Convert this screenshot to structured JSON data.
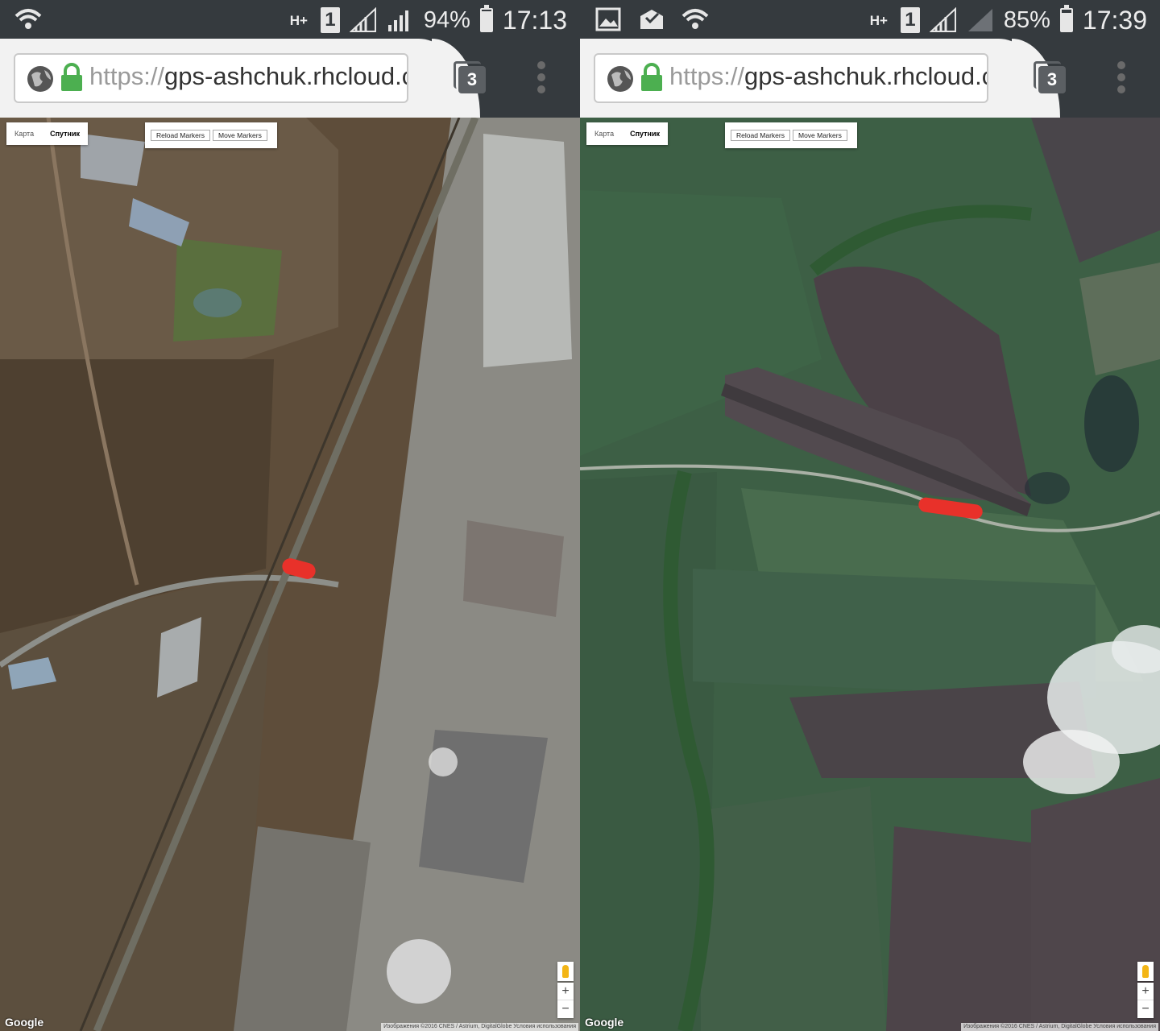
{
  "screens": [
    {
      "status": {
        "battery": "94%",
        "time": "17:13",
        "network": "H+",
        "sim": "1",
        "battery_level": 0.94
      },
      "browser": {
        "url_scheme": "https://",
        "url_host": "gps-ashchuk.rhcloud.c",
        "tab_count": "3"
      },
      "map": {
        "type_tabs": [
          "Карта",
          "Спутник"
        ],
        "active_type": "Спутник",
        "buttons": {
          "reload": "Reload Markers",
          "move": "Move Markers"
        },
        "zoom_in": "+",
        "zoom_out": "−",
        "logo": "Google",
        "attribution": "Изображения ©2016 CNES / Astrium, DigitalGlobe   Условия использования"
      }
    },
    {
      "status": {
        "battery": "85%",
        "time": "17:39",
        "network": "H+",
        "sim": "1",
        "battery_level": 0.85
      },
      "browser": {
        "url_scheme": "https://",
        "url_host": "gps-ashchuk.rhcloud.c",
        "tab_count": "3"
      },
      "map": {
        "type_tabs": [
          "Карта",
          "Спутник"
        ],
        "active_type": "Спутник",
        "buttons": {
          "reload": "Reload Markers",
          "move": "Move Markers"
        },
        "zoom_in": "+",
        "zoom_out": "−",
        "logo": "Google",
        "attribution": "Изображения ©2016 CNES / Astrium, DigitalGlobe   Условия использования"
      }
    }
  ],
  "colors": {
    "status_bar": "#353a3e",
    "marker": "#e8312a",
    "lock": "#4caf50"
  }
}
